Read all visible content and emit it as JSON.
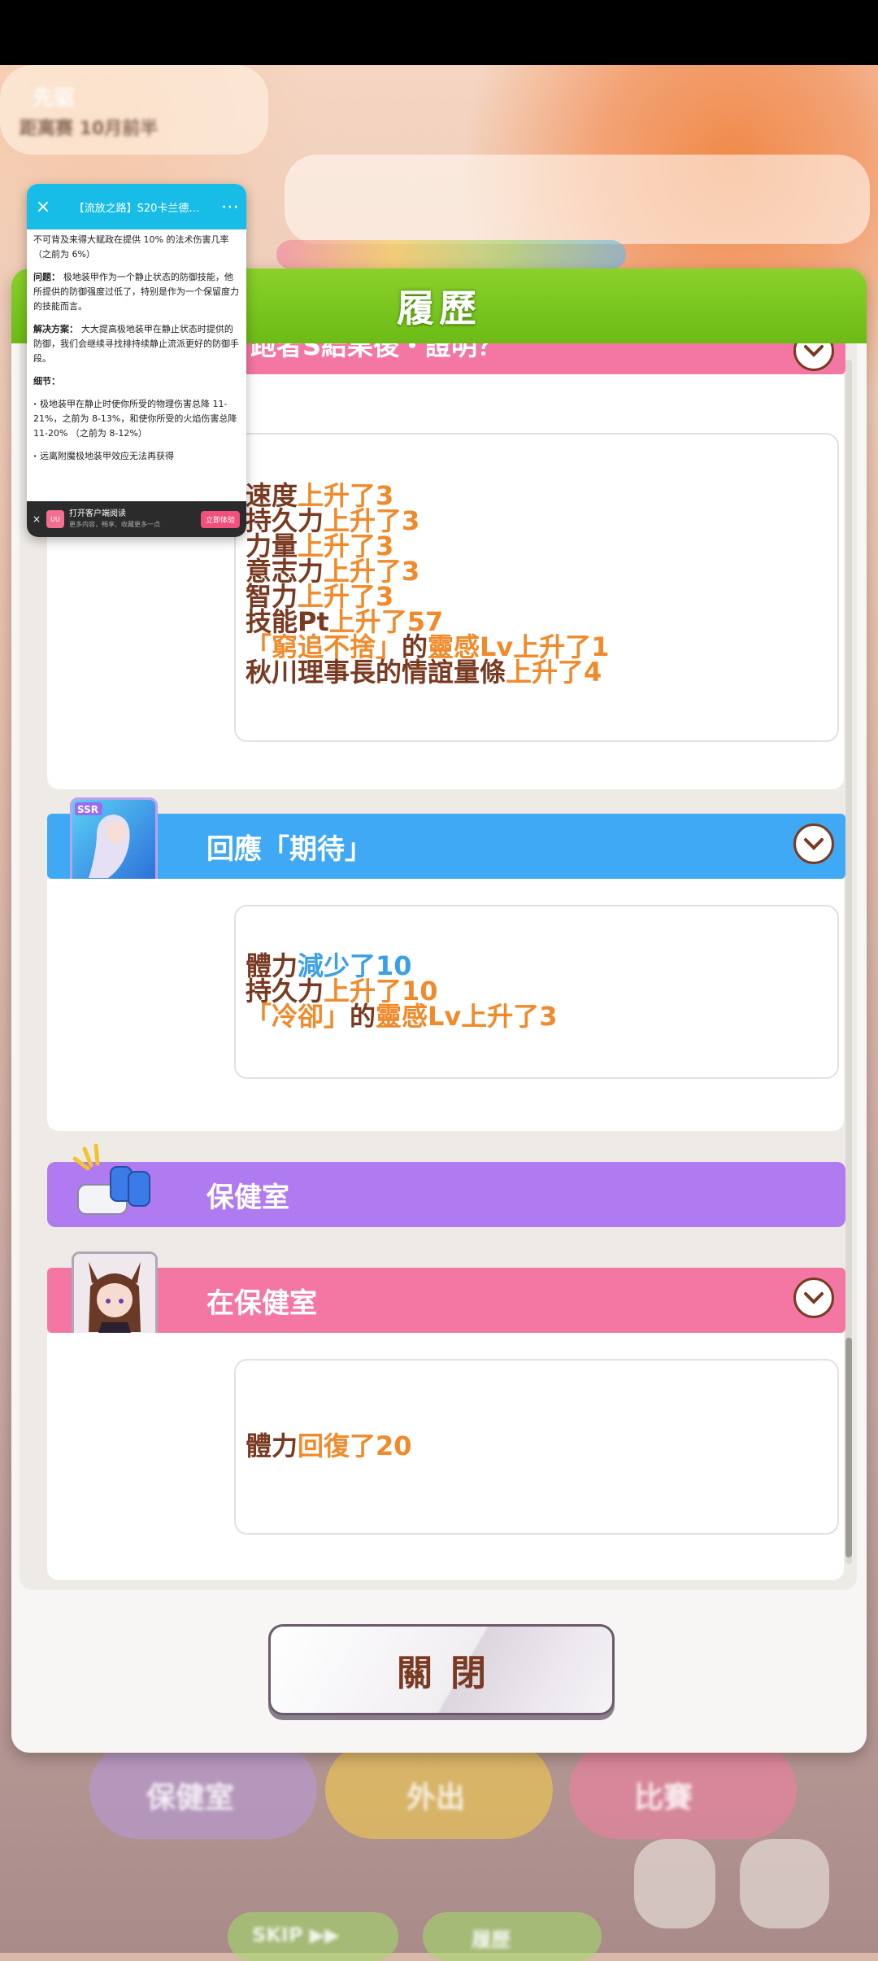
{
  "dialog": {
    "title": "履歷",
    "close_label": "關閉"
  },
  "events": [
    {
      "title": "跑者S給果後・證明？",
      "effects": [
        {
          "parts": [
            [
              "速度",
              ""
            ],
            [
              "上升了3",
              "up"
            ]
          ]
        },
        {
          "parts": [
            [
              "持久力",
              ""
            ],
            [
              "上升了3",
              "up"
            ]
          ]
        },
        {
          "parts": [
            [
              "力量",
              ""
            ],
            [
              "上升了3",
              "up"
            ]
          ]
        },
        {
          "parts": [
            [
              "意志力",
              ""
            ],
            [
              "上升了3",
              "up"
            ]
          ]
        },
        {
          "parts": [
            [
              "智力",
              ""
            ],
            [
              "上升了3",
              "up"
            ]
          ]
        },
        {
          "parts": [
            [
              "技能Pt",
              ""
            ],
            [
              "上升了57",
              "up"
            ]
          ]
        },
        {
          "parts": [
            [
              "「窮追不捨」",
              "up"
            ],
            [
              "的",
              ""
            ],
            [
              "靈感Lv上升了1",
              "up"
            ]
          ]
        },
        {
          "parts": [
            [
              "秋川理事長的情誼量條",
              ""
            ],
            [
              "上升了4",
              "up"
            ]
          ]
        }
      ]
    },
    {
      "title": "回應「期待」",
      "badge": "SSR",
      "effects": [
        {
          "parts": [
            [
              "體力",
              ""
            ],
            [
              "減少了10",
              "down"
            ]
          ]
        },
        {
          "parts": [
            [
              "持久力",
              ""
            ],
            [
              "上升了10",
              "up"
            ]
          ]
        },
        {
          "parts": [
            [
              "「冷卻」",
              "up"
            ],
            [
              "的",
              ""
            ],
            [
              "靈感Lv上升了3",
              "up"
            ]
          ]
        }
      ]
    },
    {
      "title": "保健室"
    },
    {
      "title": "在保健室",
      "effects": [
        {
          "parts": [
            [
              "體力",
              ""
            ],
            [
              "回復了20",
              "up"
            ]
          ]
        }
      ]
    }
  ],
  "overlay": {
    "title": "【流放之路】S20卡兰德…",
    "paragraphs": [
      {
        "label": "",
        "text": "不可背及来得大赋政在提供 10% 的法术伤害几率 （之前为 6%）"
      },
      {
        "label": "问题：",
        "text": "极地装甲作为一个静止状态的防御技能，他所提供的防御强度过低了，特别是作为一个保留度力的技能而言。"
      },
      {
        "label": "解决方案：",
        "text": "大大提高极地装甲在静止状态时提供的防御，我们会继续寻找排持续静止流派更好的防御手段。"
      },
      {
        "label": "细节：",
        "text": ""
      },
      {
        "label": "·",
        "text": "极地装甲在静止时使你所受的物理伤害总降 11-21%，之前为 8-13%，和使你所受的火焰伤害总降 11-20% （之前为 8-12%）"
      },
      {
        "label": "·",
        "text": "远离附魔极地装甲效应无法再获得"
      }
    ],
    "footer_main": "打开客户端阅读",
    "footer_sub": "更多内容，畅享、收藏更多一点",
    "open_label": "立即体验",
    "app_logo_text": "UU"
  },
  "background": {
    "left_text_1": "先驱",
    "left_text_2": "距离赛 10月前半",
    "bottom_btn_1": "保健室",
    "bottom_btn_2": "外出",
    "bottom_btn_3": "比賽",
    "skip_label": "SKIP ▶▶",
    "log_label": "履歷"
  },
  "colors": {
    "header_green": "#7ac51f",
    "banner_pink": "#f477a3",
    "banner_blue": "#3fa9f5",
    "banner_purple": "#b07af0",
    "text_brown": "#7a3a22",
    "up_orange": "#f08a2a",
    "down_blue": "#3aa0e8"
  }
}
